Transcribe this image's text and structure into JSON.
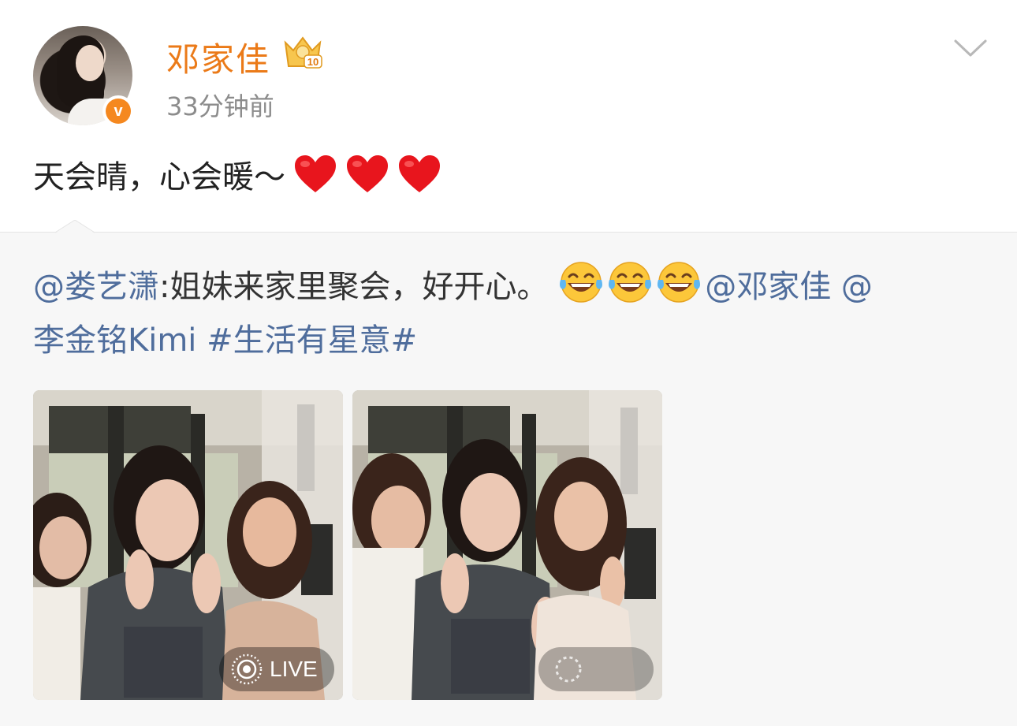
{
  "header": {
    "user_name": "邓家佳",
    "post_time": "33分钟前",
    "verified_badge_letter": "v",
    "level_badge_number": "10"
  },
  "post": {
    "text": "天会晴，心会暖～",
    "hearts_icon": "red-heart-emoji",
    "heart_count": 3
  },
  "repost": {
    "author_mention": "@娄艺潇",
    "colon": ":",
    "text": "姐妹来家里聚会，好开心。",
    "laugh_icon": "tears-of-joy-emoji",
    "mention_1": "@邓家佳",
    "mention_2_prefix": "@",
    "mention_2": "李金铭Kimi",
    "hashtag": "#生活有星意#",
    "photos": [
      {
        "alt": "three-women-peace-sign-photo-1",
        "live_label": "LIVE"
      },
      {
        "alt": "three-women-peace-sign-photo-2"
      }
    ]
  },
  "colors": {
    "name": "#eb7a18",
    "link": "#4f6d9c",
    "badge": "#f5881f",
    "repost_bg": "#f7f7f7"
  }
}
